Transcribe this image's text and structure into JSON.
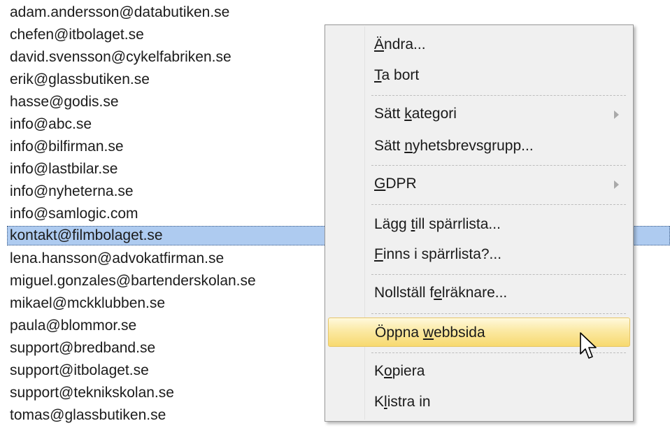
{
  "emails": [
    "adam.andersson@databutiken.se",
    "chefen@itbolaget.se",
    "david.svensson@cykelfabriken.se",
    "erik@glassbutiken.se",
    "hasse@godis.se",
    "info@abc.se",
    "info@bilfirman.se",
    "info@lastbilar.se",
    "info@nyheterna.se",
    "info@samlogic.com",
    "kontakt@filmbolaget.se",
    "lena.hansson@advokatfirman.se",
    "miguel.gonzales@bartenderskolan.se",
    "mikael@mckklubben.se",
    "paula@blommor.se",
    "support@bredband.se",
    "support@itbolaget.se",
    "support@teknikskolan.se",
    "tomas@glassbutiken.se"
  ],
  "selected_email": "kontakt@filmbolaget.se",
  "context_menu": {
    "items": [
      {
        "label": "Ändra...",
        "access_key": "Ä"
      },
      {
        "label": "Ta bort",
        "access_key": "T"
      },
      {
        "label": "Sätt kategori",
        "access_key": "k",
        "submenu": true
      },
      {
        "label": "Sätt nyhetsbrevsgrupp...",
        "access_key": "n"
      },
      {
        "label": "GDPR",
        "access_key": "G",
        "submenu": true
      },
      {
        "label": "Lägg till spärrlista...",
        "access_key": "t"
      },
      {
        "label": "Finns i spärrlista?...",
        "access_key": "F"
      },
      {
        "label": "Nollställ felräknare...",
        "access_key": "e"
      },
      {
        "label": "Öppna webbsida",
        "access_key": "w",
        "highlighted": true
      },
      {
        "label": "Kopiera",
        "access_key": "o"
      },
      {
        "label": "Klistra in",
        "access_key": "l"
      }
    ]
  },
  "colors": {
    "selection": "#aecbf0",
    "menu_background": "#f0f0f0",
    "menu_highlight": "#f7d96f"
  }
}
